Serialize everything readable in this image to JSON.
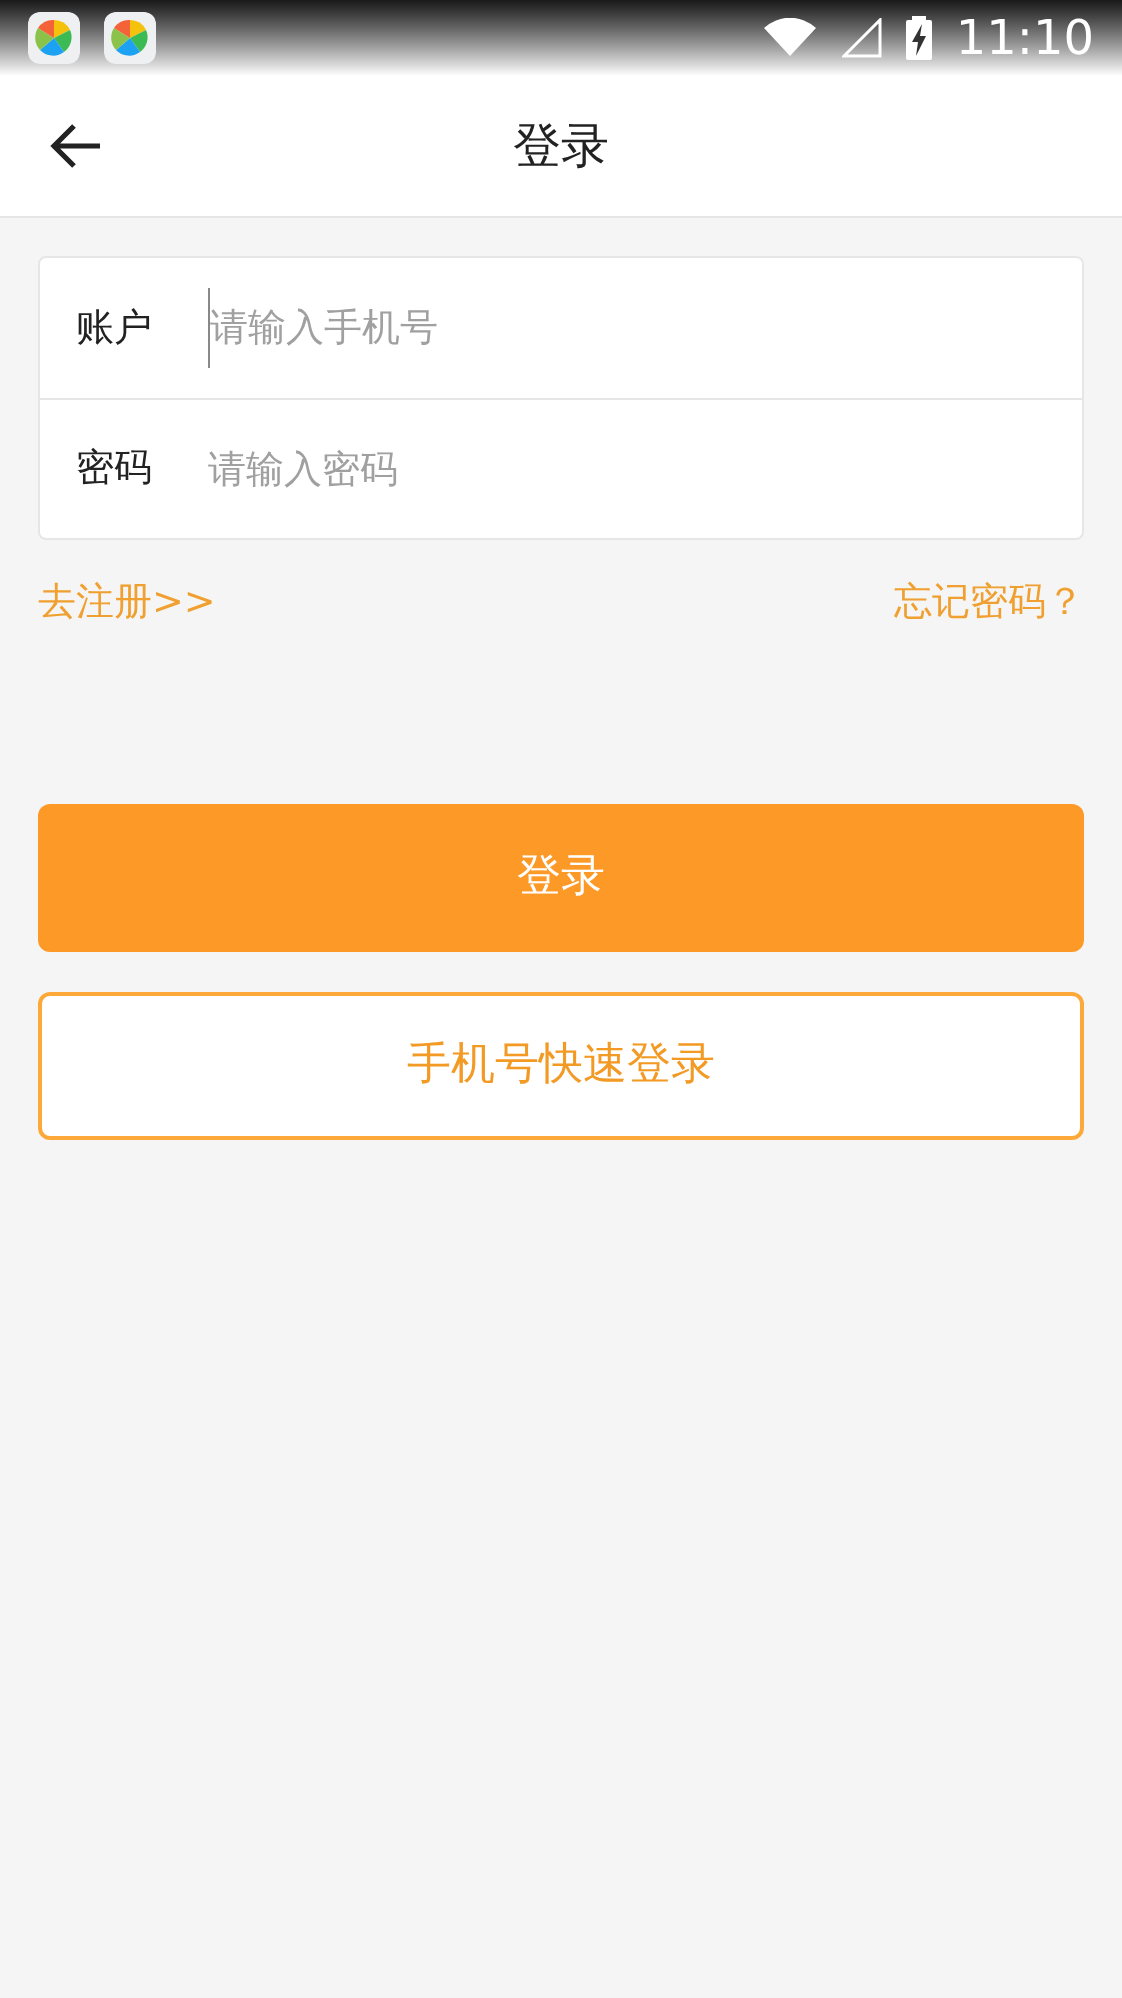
{
  "status_bar": {
    "time": "11:10"
  },
  "header": {
    "title": "登录"
  },
  "fields": [
    {
      "label": "账户",
      "placeholder": "请输入手机号",
      "focused": true
    },
    {
      "label": "密码",
      "placeholder": "请输入密码",
      "focused": false
    }
  ],
  "links": {
    "register": "去注册>>",
    "forgot": "忘记密码？"
  },
  "buttons": [
    {
      "label": "登录",
      "kind": "primary"
    },
    {
      "label": "手机号快速登录",
      "kind": "outline"
    }
  ]
}
